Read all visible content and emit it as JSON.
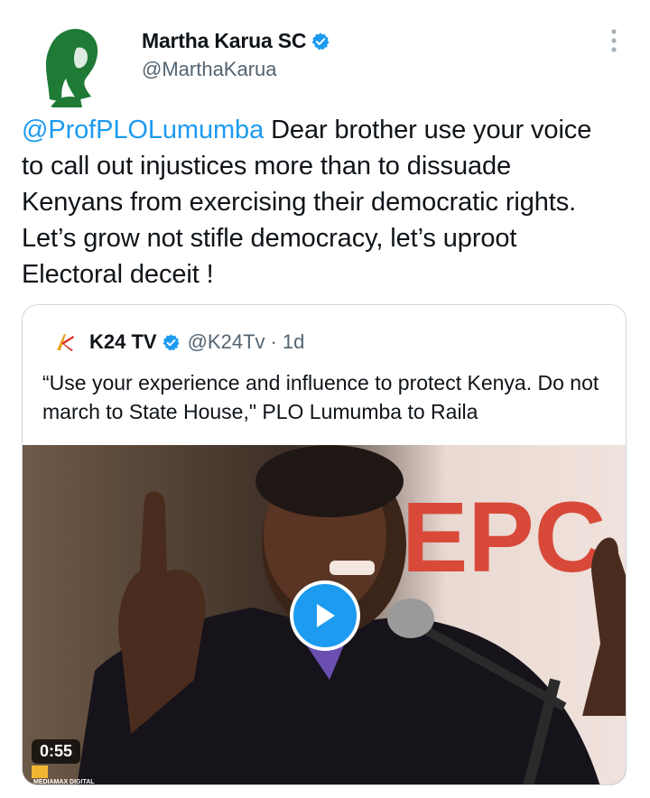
{
  "author": {
    "display_name": "Martha Karua SC",
    "handle": "@MarthaKarua",
    "avatar_color": "#1f7a35"
  },
  "menu_icon": "more-vertical-icon",
  "tweet": {
    "mention": "@ProfPLOLumumba",
    "body": " Dear brother use your voice to call out injustices more than to dissuade  Kenyans from exercising their democratic rights. Let’s grow not stifle democracy, let’s uproot Electoral deceit !"
  },
  "quoted": {
    "display_name": "K24 TV",
    "handle": "@K24Tv",
    "separator": "·",
    "time": "1d",
    "text": "“Use your experience and influence to protect Kenya. Do not march to State House,\" PLO Lumumba to Raila",
    "video": {
      "duration": "0:55",
      "watermark_text": "MEDIAMAX DIGITAL",
      "banner_text": "EPC"
    }
  },
  "colors": {
    "accent": "#1d9bf0",
    "text": "#0f1419",
    "secondary": "#536471",
    "border": "#cfd9de"
  }
}
